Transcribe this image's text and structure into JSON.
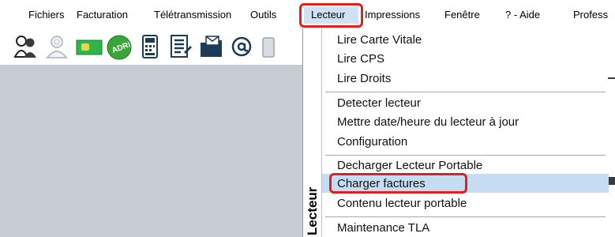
{
  "menubar": {
    "items": [
      "Fichiers",
      "Facturation",
      "Télétransmission",
      "Outils",
      "Lecteur",
      "Impressions",
      "Fenêtre",
      "? - Aide",
      "Profess"
    ],
    "active_index": 4
  },
  "toolbar": {
    "icons": [
      "users-icon",
      "user-search-icon",
      "card-icon",
      "adri-icon",
      "reader-device-icon",
      "document-icon",
      "folder-mail-icon",
      "at-icon"
    ],
    "adri_text": "ADRi"
  },
  "dropdown": {
    "side_label": "Lecteur",
    "groups": [
      [
        "Lire Carte Vitale",
        "Lire CPS",
        "Lire Droits"
      ],
      [
        "Detecter lecteur",
        "Mettre date/heure du lecteur à jour",
        "Configuration"
      ],
      [
        "Decharger Lecteur Portable",
        "Charger factures",
        "Contenu lecteur portable"
      ],
      [
        "Maintenance TLA"
      ]
    ],
    "highlighted_item": "Charger factures"
  },
  "colors": {
    "highlight": "#c5dcf2",
    "annotation_red": "#e02020",
    "workspace": "#c8ccd3"
  }
}
